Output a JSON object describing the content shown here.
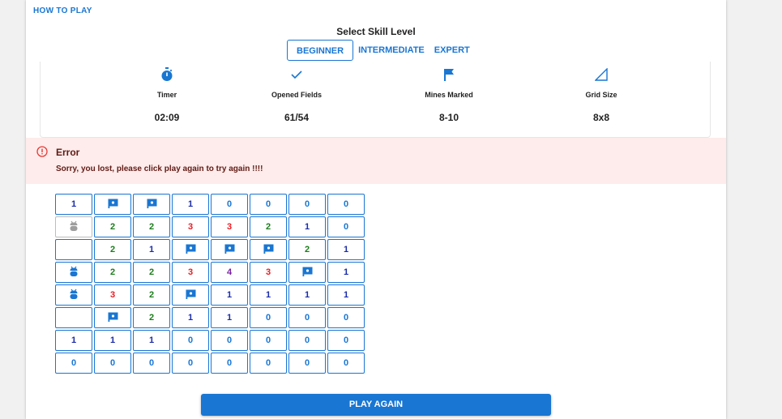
{
  "header": {
    "how_to_play": "HOW TO PLAY"
  },
  "skill": {
    "title": "Select Skill Level",
    "levels": [
      "BEGINNER",
      "INTERMEDIATE",
      "EXPERT"
    ],
    "selected": "BEGINNER"
  },
  "stats": [
    {
      "icon": "stopwatch-icon",
      "label": "Timer",
      "value": "02:09"
    },
    {
      "icon": "check-icon",
      "label": "Opened Fields",
      "value": "61/54"
    },
    {
      "icon": "flag-icon",
      "label": "Mines Marked",
      "value": "8-10"
    },
    {
      "icon": "triangle-ruler-icon",
      "label": "Grid Size",
      "value": "8x8"
    }
  ],
  "alert": {
    "title": "Error",
    "message": "Sorry, you lost, please click play again to try again !!!!"
  },
  "board": [
    [
      "1",
      "F",
      "F",
      "1",
      "0",
      "0",
      "0",
      "0"
    ],
    [
      "M",
      "2",
      "2",
      "3",
      "3",
      "2",
      "1",
      "0"
    ],
    [
      "",
      "2",
      "1",
      "F",
      "F",
      "F",
      "2",
      "1"
    ],
    [
      "B",
      "2",
      "2",
      "3",
      "4",
      "3",
      "F",
      "1"
    ],
    [
      "B",
      "3",
      "2",
      "F",
      "1",
      "1",
      "1",
      "1"
    ],
    [
      "",
      "F",
      "2",
      "1",
      "1",
      "0",
      "0",
      "0"
    ],
    [
      "1",
      "1",
      "1",
      "0",
      "0",
      "0",
      "0",
      "0"
    ],
    [
      "0",
      "0",
      "0",
      "0",
      "0",
      "0",
      "0",
      "0"
    ]
  ],
  "board_legend": {
    "F": "flag-icon",
    "M": "grey-bug-icon",
    "B": "bug-icon"
  },
  "colors": {
    "primary": "#1976d2",
    "error_bg": "#fdeceb",
    "error_text": "#611a15",
    "n1": "#1a2ca8",
    "n2": "#1b7d1b",
    "n3": "#e51c23",
    "n4": "#7b1fa2"
  },
  "play_button": "PLAY AGAIN"
}
